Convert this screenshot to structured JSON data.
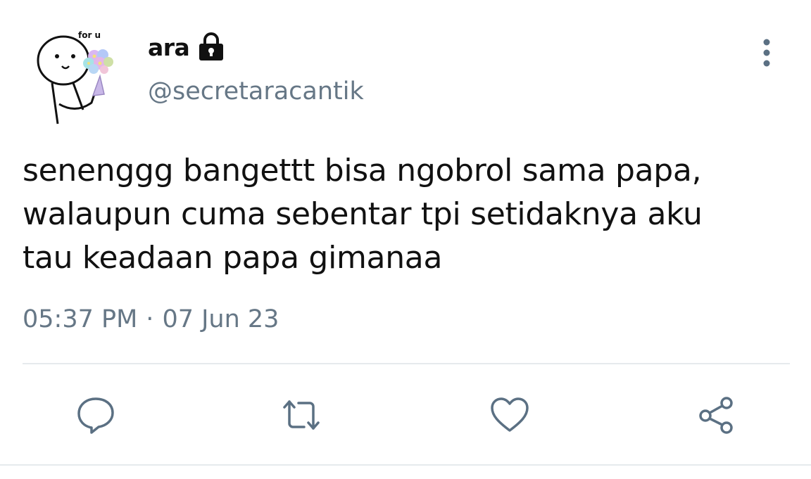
{
  "tweet": {
    "avatar": {
      "caption": "for u",
      "description": "doodle-with-flowers"
    },
    "display_name": "ara",
    "protected_icon": "lock-icon",
    "handle": "@secretaracantik",
    "text": "senenggg bangettt bisa ngobrol sama papa,\nwalaupun cuma sebentar tpi setidaknya aku\ntau keadaan papa gimanaa",
    "time": "05:37 PM",
    "separator": "·",
    "date": "07 Jun 23"
  },
  "actions": [
    {
      "name": "reply",
      "icon": "comment-icon"
    },
    {
      "name": "retweet",
      "icon": "retweet-icon"
    },
    {
      "name": "like",
      "icon": "heart-icon"
    },
    {
      "name": "share",
      "icon": "share-icon"
    }
  ],
  "colors": {
    "text": "#111111",
    "secondary": "#667786",
    "icon": "#5b7083",
    "divider": "#e6eaed"
  }
}
